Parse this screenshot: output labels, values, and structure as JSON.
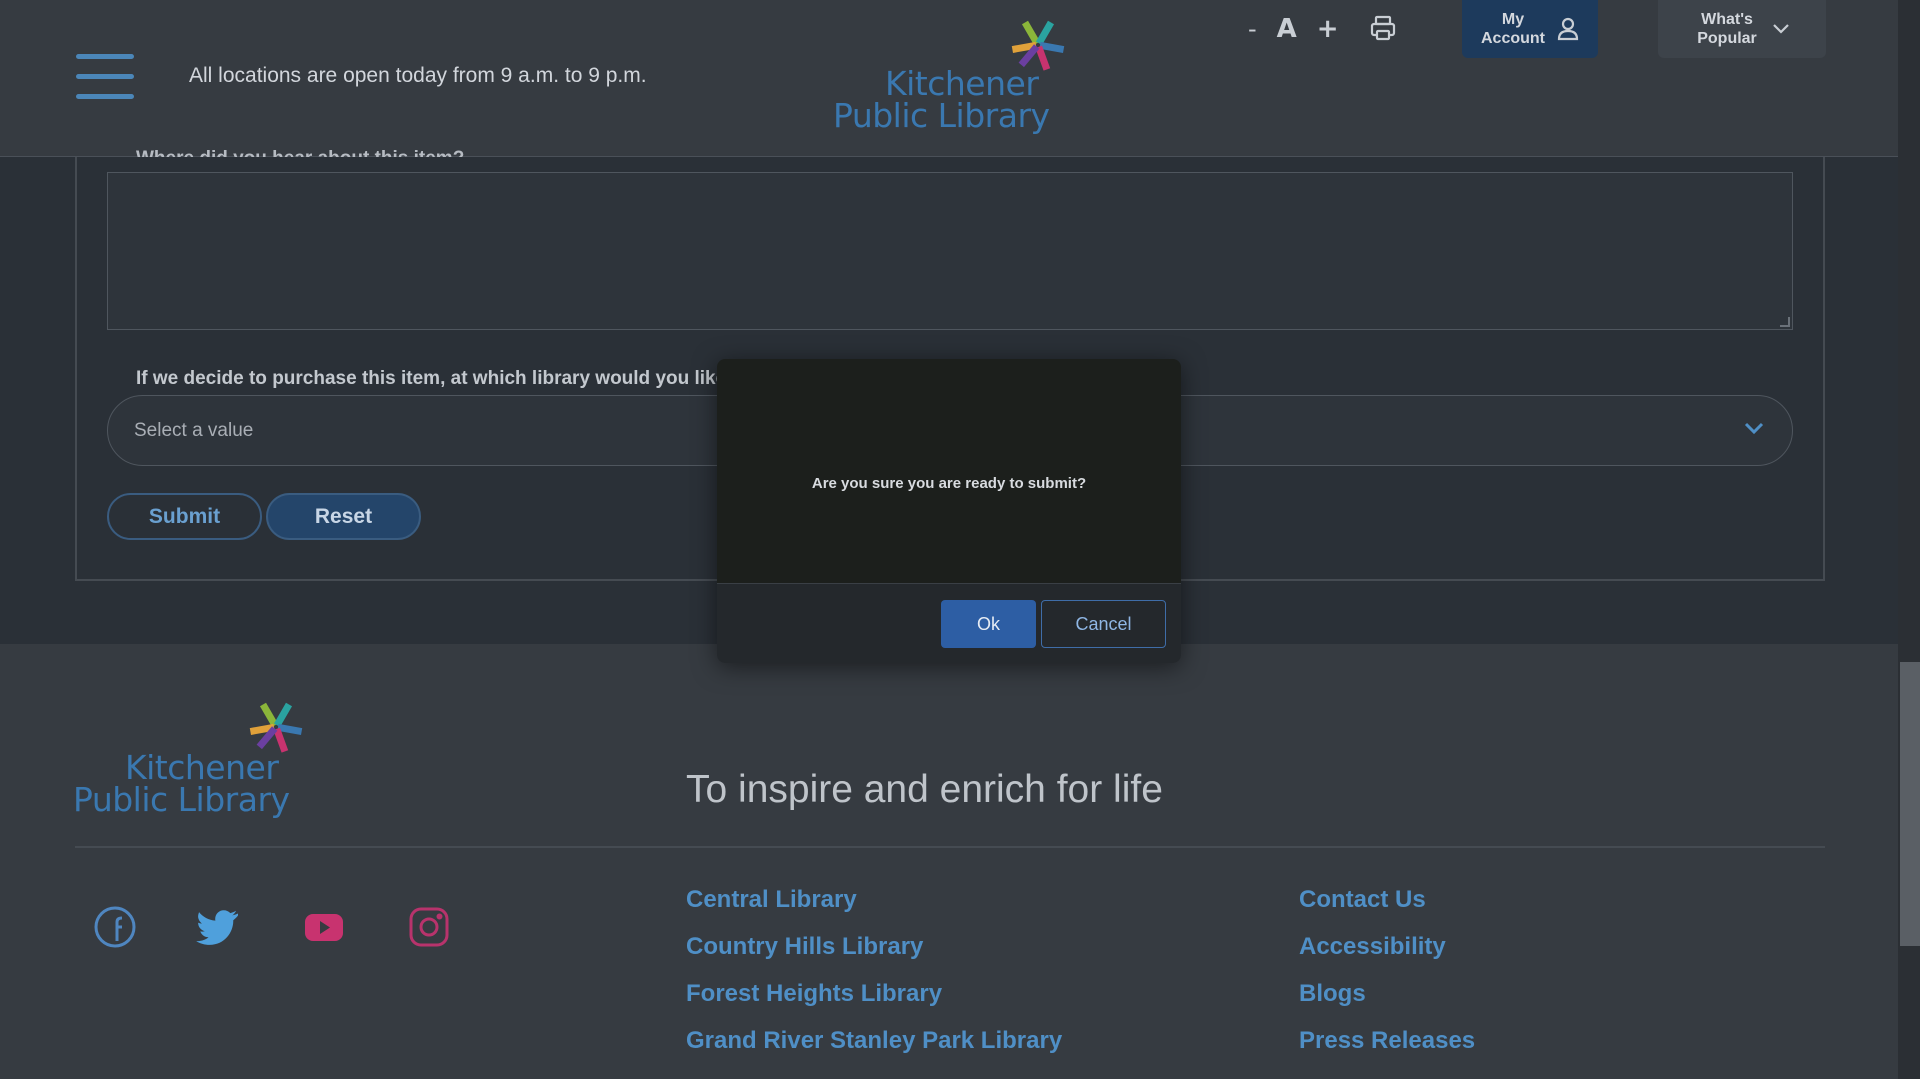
{
  "header": {
    "hours_text": "All locations are open today from 9 a.m. to 9 p.m.",
    "logo_line1": "Kitchener",
    "logo_line2": "Public Library",
    "font_decrease": "-",
    "font_label": "A",
    "font_increase": "+",
    "my_account": "My Account",
    "whats_popular": "What's Popular"
  },
  "form": {
    "cut_label": "Where did you hear about this item?",
    "question_start": "If we decide to purchase this item, at which library would you like t",
    "question_end": ")",
    "select_value": "Select a value",
    "submit_label": "Submit",
    "reset_label": "Reset"
  },
  "modal": {
    "message": "Are you sure you are ready to submit?",
    "ok_label": "Ok",
    "cancel_label": "Cancel"
  },
  "footer": {
    "logo_line1": "Kitchener",
    "logo_line2": "Public Library",
    "tagline": "To inspire and enrich for life",
    "locations": [
      "Central Library",
      "Country Hills Library",
      "Forest Heights Library",
      "Grand River Stanley Park Library"
    ],
    "info_links": [
      "Contact Us",
      "Accessibility",
      "Blogs",
      "Press Releases"
    ],
    "social_icons": [
      "facebook-icon",
      "twitter-icon",
      "youtube-icon",
      "instagram-icon"
    ]
  },
  "colors": {
    "accent_blue": "#4f8fc6",
    "dark_blue": "#1d3a5c",
    "ok_button": "#2d5ea4",
    "logo_green": "#8bb63a",
    "logo_pink": "#c8336f",
    "logo_blue": "#3a78b0",
    "logo_teal": "#2aa3a0"
  }
}
